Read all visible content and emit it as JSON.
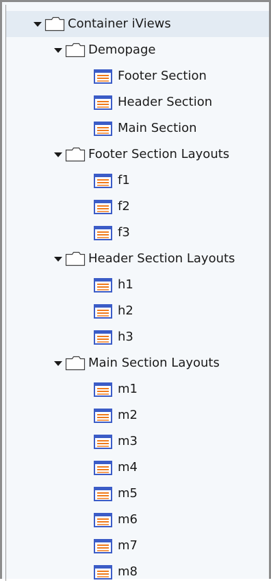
{
  "tree": {
    "root": {
      "label": "Container iViews",
      "expanded": true,
      "icon": "folder-icon"
    },
    "folders": [
      {
        "label": "Demopage",
        "expanded": true,
        "icon": "folder-icon",
        "items": [
          "Footer Section",
          "Header Section",
          "Main Section"
        ]
      },
      {
        "label": "Footer Section Layouts",
        "expanded": true,
        "icon": "folder-icon",
        "items": [
          "f1",
          "f2",
          "f3"
        ]
      },
      {
        "label": "Header Section Layouts",
        "expanded": true,
        "icon": "folder-icon",
        "items": [
          "h1",
          "h2",
          "h3"
        ]
      },
      {
        "label": "Main Section Layouts",
        "expanded": true,
        "icon": "folder-icon",
        "items": [
          "m1",
          "m2",
          "m3",
          "m4",
          "m5",
          "m6",
          "m7",
          "m8"
        ]
      }
    ],
    "item_icon": "iview-page-icon",
    "colors": {
      "selected_row_bg": "#e3ebf3",
      "panel_bg": "#f5f8fb",
      "page_icon_frame": "#3b5cc7",
      "page_icon_lines": "#f07a1a"
    }
  }
}
